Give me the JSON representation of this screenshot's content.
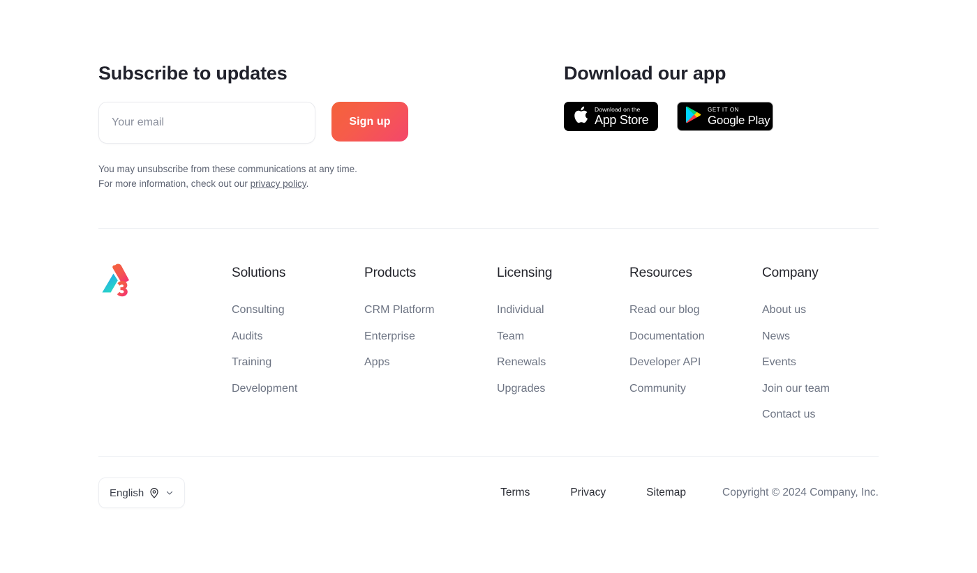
{
  "subscribe": {
    "heading": "Subscribe to updates",
    "email_placeholder": "Your email",
    "email_value": "",
    "signup_label": "Sign up",
    "disclaimer_line1": "You may unsubscribe from these communications at any time.",
    "disclaimer_line2_prefix": "For more information, check out our ",
    "privacy_link": "privacy policy",
    "disclaimer_line2_suffix": "."
  },
  "download": {
    "heading": "Download our app",
    "app_store": {
      "icon": "apple-icon",
      "small_text": "Download on the",
      "big_text": "App Store"
    },
    "google_play": {
      "icon": "google-play-icon",
      "small_text": "GET IT ON",
      "big_text": "Google Play"
    }
  },
  "brand": {
    "logo_icon": "company-a3-logo"
  },
  "footer_nav": [
    {
      "title": "Solutions",
      "links": [
        "Consulting",
        "Audits",
        "Training",
        "Development"
      ]
    },
    {
      "title": "Products",
      "links": [
        "CRM Platform",
        "Enterprise",
        "Apps"
      ]
    },
    {
      "title": "Licensing",
      "links": [
        "Individual",
        "Team",
        "Renewals",
        "Upgrades"
      ]
    },
    {
      "title": "Resources",
      "links": [
        "Read our blog",
        "Documentation",
        "Developer API",
        "Community"
      ]
    },
    {
      "title": "Company",
      "links": [
        "About us",
        "News",
        "Events",
        "Join our team",
        "Contact us"
      ]
    }
  ],
  "bottom_bar": {
    "language": {
      "label": "English",
      "pin_icon": "location-pin-icon",
      "chevron_icon": "chevron-down-icon"
    },
    "legal_links": [
      "Terms",
      "Privacy",
      "Sitemap"
    ],
    "copyright": "Copyright © 2024 Company, Inc."
  },
  "colors": {
    "accent_start": "#f4623a",
    "accent_end": "#f4476b",
    "heading": "#21222c",
    "link": "#6d7483",
    "divider": "#eceef2"
  }
}
